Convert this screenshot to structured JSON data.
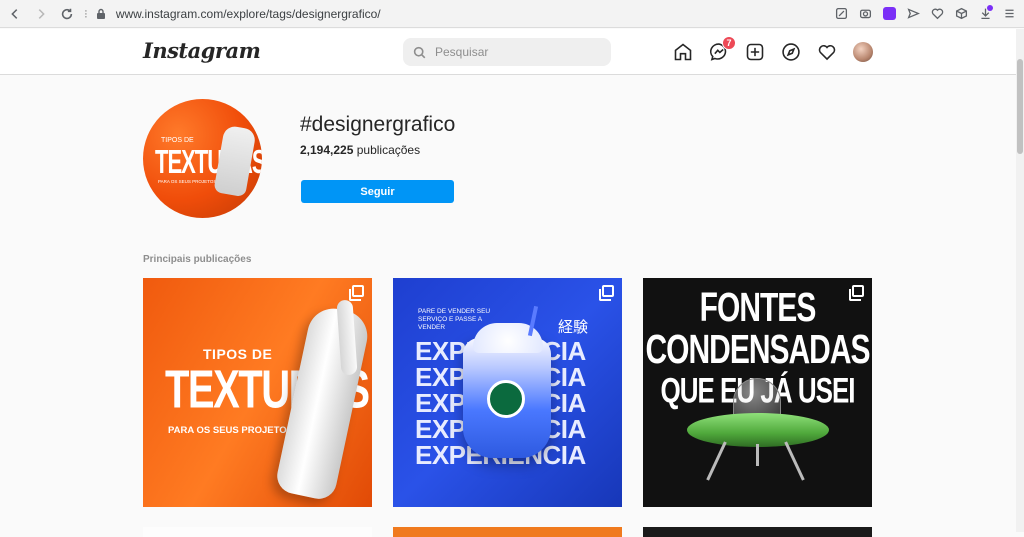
{
  "browser": {
    "url": "www.instagram.com/explore/tags/designergrafico/",
    "icons": [
      "back-arrow-icon",
      "forward-arrow-icon",
      "reload-icon",
      "lock-icon",
      "edit-icon",
      "camera-icon",
      "shield-icon",
      "send-icon",
      "heart-icon",
      "cube-icon",
      "download-icon",
      "menu-icon"
    ]
  },
  "header": {
    "logo": "Instagram",
    "search_placeholder": "Pesquisar",
    "messages_badge": "7"
  },
  "tag": {
    "title": "#designergrafico",
    "post_count": "2,194,225",
    "post_count_label": "publicações",
    "follow_label": "Seguir",
    "profile_image_text": {
      "line1": "TIPOS DE",
      "line2": "TEXTURAS",
      "line3": "PARA OS SEUS PROJETOS"
    }
  },
  "section": {
    "title": "Principais publicações"
  },
  "posts": [
    {
      "line1": "TIPOS DE",
      "line2": "TEXTURAS",
      "line3": "PARA OS SEUS PROJETOS",
      "colors": [
        "#f05a0e",
        "#ff7b22"
      ]
    },
    {
      "small_text": "PARE DE VENDER SEU SERVIÇO E PASSE A VENDER",
      "kanji": "経験",
      "repeat_word": "EXPERIENCIA",
      "colors": [
        "#1e3fd0",
        "#2a52e8"
      ]
    },
    {
      "line1": "FONTES",
      "line2": "CONDENSADAS",
      "line3": "QUE EU JÁ USEI",
      "colors": [
        "#111111",
        "#4fa83b"
      ]
    }
  ]
}
